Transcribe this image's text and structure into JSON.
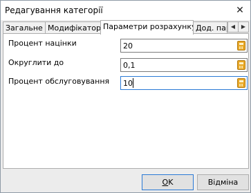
{
  "window": {
    "title": "Редагування категорії",
    "close_glyph": "✕"
  },
  "tabs": [
    {
      "label": "Загальне",
      "active": false
    },
    {
      "label": "Модифікатори",
      "active": false
    },
    {
      "label": "Параметри розрахунку",
      "active": true
    },
    {
      "label": "Дод. пар",
      "active": false
    }
  ],
  "tab_scroll": {
    "left_glyph": "◀",
    "right_glyph": "▶"
  },
  "fields": [
    {
      "label": "Процент націнки",
      "value": "20"
    },
    {
      "label": "Округлити до",
      "value": "0,1"
    },
    {
      "label": "Процент обслуговування",
      "value": "10"
    }
  ],
  "buttons": {
    "ok_prefix": "",
    "ok_mnemonic": "O",
    "ok_rest": "K",
    "cancel": "Відміна"
  },
  "icons": {
    "close": "close-icon",
    "calculator": "calculator-icon"
  }
}
